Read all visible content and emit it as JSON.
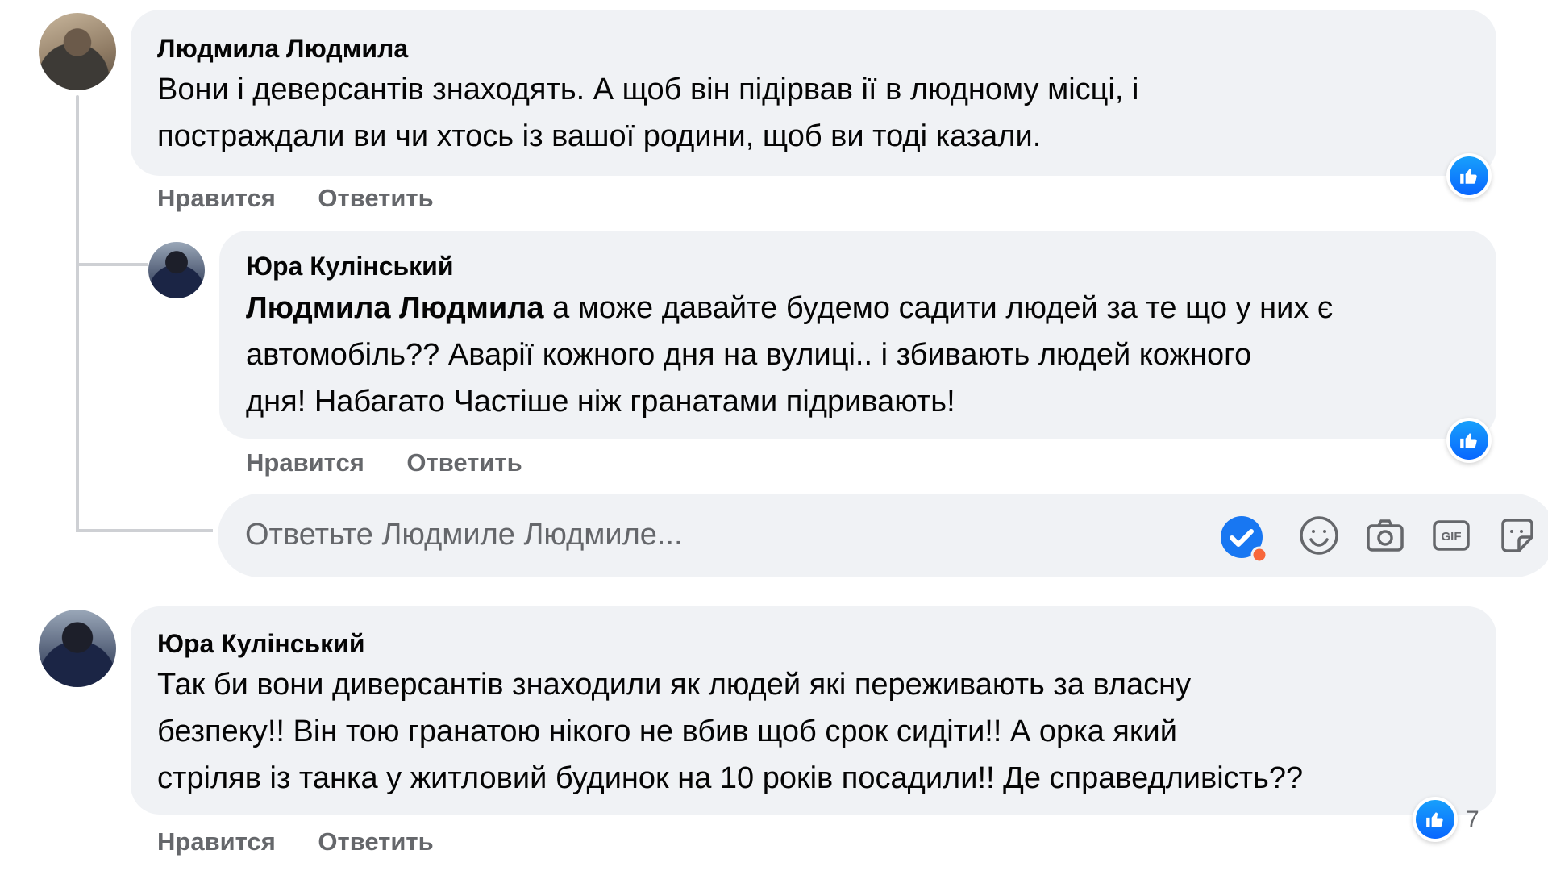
{
  "comments": [
    {
      "author": "Людмила Людмила",
      "lines": [
        "Вони і деверсантів знаходять. А щоб він підірвав ії в людному місці, і",
        "постраждали ви чи хтось із вашої родини, щоб ви тоді казали."
      ],
      "actions": {
        "like": "Нравится",
        "reply": "Ответить"
      }
    },
    {
      "author": "Юра Кулінський",
      "mention": "Людмила Людмила",
      "lines": [
        " а може давайте будемо садити людей за те що у них є",
        "автомобіль?? Аварії кожного дня на вулиці.. і збивають людей кожного",
        "дня! Набагато Частіше ніж гранатами підривають!"
      ],
      "actions": {
        "like": "Нравится",
        "reply": "Ответить"
      }
    },
    {
      "author": "Юра Кулінський",
      "lines": [
        "Так би вони диверсантів знаходили як людей які переживають за власну",
        "безпеку!! Він тою гранатою нікого не вбив щоб срок сидіти!! А орка який",
        "стріляв із танка у житловий будинок на 10 років посадили!! Де справедливість??"
      ],
      "reaction_count": "7",
      "actions": {
        "like": "Нравится",
        "reply": "Ответить"
      }
    }
  ],
  "reply_box": {
    "placeholder": "Ответьте Людмиле Людмиле...",
    "icons": [
      "check-badge-icon",
      "emoji-icon",
      "camera-icon",
      "gif-icon",
      "sticker-icon"
    ]
  },
  "colors": {
    "bubble": "#f0f2f5",
    "like_blue": "#0866ff",
    "secondary_text": "#65676b"
  }
}
